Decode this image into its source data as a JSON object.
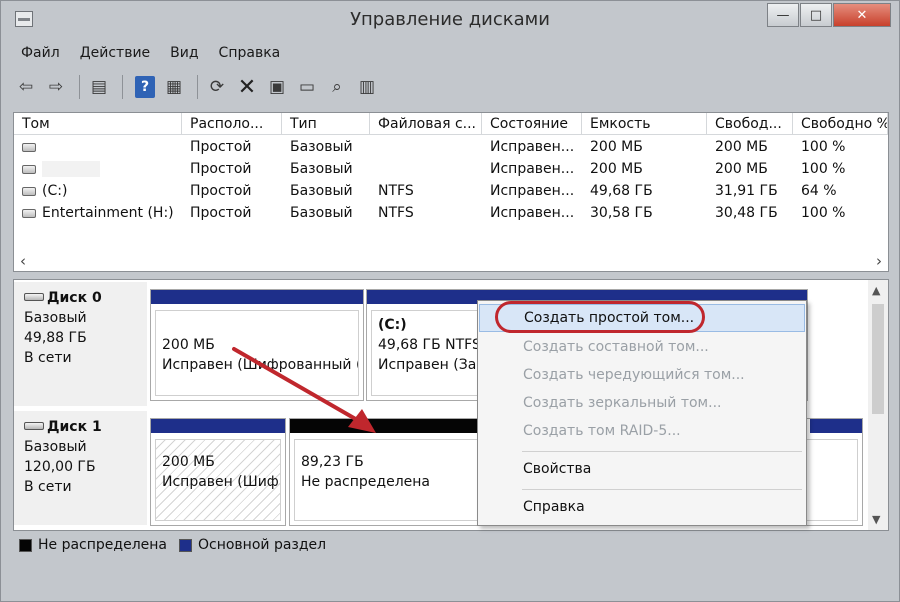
{
  "window": {
    "title": "Управление дисками",
    "controls": {
      "minimize": "—",
      "maximize": "□",
      "close": "✕"
    }
  },
  "menu": [
    "Файл",
    "Действие",
    "Вид",
    "Справка"
  ],
  "toolbar": [
    "back-icon",
    "forward-icon",
    "properties-icon",
    "help-icon",
    "list-icon",
    "refresh-icon",
    "delete-icon",
    "disk-icon",
    "open-folder-icon",
    "search-icon",
    "settings-icon"
  ],
  "volumes": {
    "columns": [
      "Том",
      "Располо...",
      "Тип",
      "Файловая с...",
      "Состояние",
      "Емкость",
      "Свобод...",
      "Свободно %"
    ],
    "rows": [
      [
        "",
        "Простой",
        "Базовый",
        "",
        "Исправен...",
        "200 МБ",
        "200 МБ",
        "100 %"
      ],
      [
        "",
        "Простой",
        "Базовый",
        "",
        "Исправен...",
        "200 МБ",
        "200 МБ",
        "100 %"
      ],
      [
        "(C:)",
        "Простой",
        "Базовый",
        "NTFS",
        "Исправен...",
        "49,68 ГБ",
        "31,91 ГБ",
        "64 %"
      ],
      [
        "Entertainment (H:)",
        "Простой",
        "Базовый",
        "NTFS",
        "Исправен...",
        "30,58 ГБ",
        "30,48 ГБ",
        "100 %"
      ]
    ]
  },
  "disks": [
    {
      "name": "Диск 0",
      "type": "Базовый",
      "size": "49,88 ГБ",
      "status": "В сети",
      "partitions": [
        {
          "label": "",
          "size": "200 МБ",
          "state": "Исправен (Шифрованный ("
        },
        {
          "label": "(C:)",
          "size": "49,68 ГБ NTFS",
          "state": "Исправен (Заг"
        }
      ]
    },
    {
      "name": "Диск 1",
      "type": "Базовый",
      "size": "120,00 ГБ",
      "status": "В сети",
      "partitions": [
        {
          "label": "",
          "size": "200 МБ",
          "state": "Исправен (Шиф"
        },
        {
          "label": "",
          "size": "89,23 ГБ",
          "state": "Не распределена"
        }
      ]
    }
  ],
  "legend": [
    {
      "label": "Не распределена",
      "color": "#050505"
    },
    {
      "label": "Основной раздел",
      "color": "#1e2f8a"
    }
  ],
  "context_menu": {
    "items": [
      {
        "label": "Создать простой том...",
        "enabled": true,
        "highlighted": true
      },
      {
        "label": "Создать составной том...",
        "enabled": false
      },
      {
        "label": "Создать чередующийся том...",
        "enabled": false
      },
      {
        "label": "Создать зеркальный том...",
        "enabled": false
      },
      {
        "label": "Создать том RAID-5...",
        "enabled": false
      },
      {
        "label": "Свойства",
        "enabled": true
      },
      {
        "label": "Справка",
        "enabled": true
      }
    ]
  },
  "colors": {
    "primary_partition": "#1e2f8a",
    "unallocated": "#050505",
    "annotation": "#c0272d"
  }
}
